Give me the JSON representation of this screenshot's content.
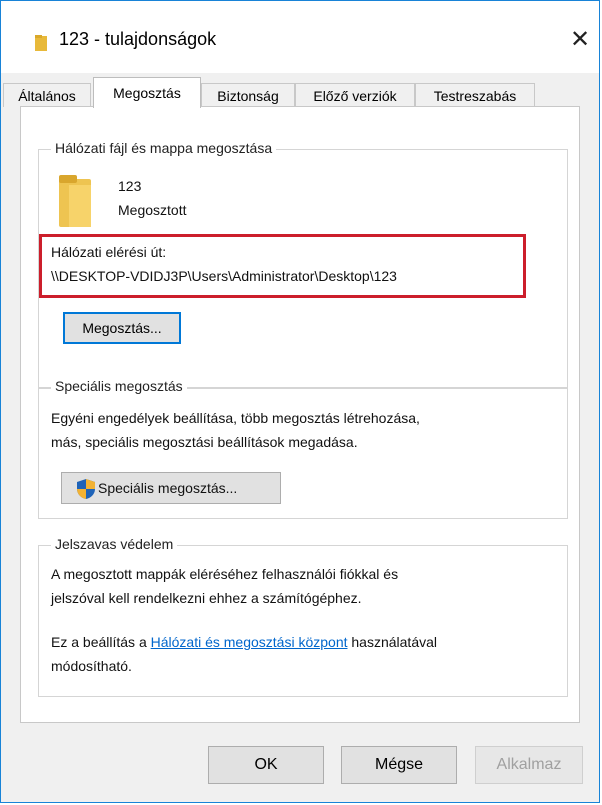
{
  "window": {
    "title": "123 - tulajdonságok",
    "close_glyph": "✕"
  },
  "tabs": [
    {
      "label": "Általános"
    },
    {
      "label": "Megosztás"
    },
    {
      "label": "Biztonság"
    },
    {
      "label": "Előző verziók"
    },
    {
      "label": "Testreszabás"
    }
  ],
  "sharing_group": {
    "title": "Hálózati fájl és mappa megosztása",
    "folder_name": "123",
    "folder_status": "Megosztott",
    "network_path_label": "Hálózati elérési út:",
    "network_path": "\\\\DESKTOP-VDIDJ3P\\Users\\Administrator\\Desktop\\123",
    "share_button": "Megosztás..."
  },
  "advanced_group": {
    "title": "Speciális megosztás",
    "description_line1": "Egyéni engedélyek beállítása, több megosztás létrehozása,",
    "description_line2": "más, speciális megosztási beállítások megadása.",
    "button": "Speciális megosztás..."
  },
  "password_group": {
    "title": "Jelszavas védelem",
    "line1": "A megosztott mappák eléréséhez felhasználói fiókkal és",
    "line2": "jelszóval kell rendelkezni ehhez a számítógéphez.",
    "line3_prefix": "Ez a beállítás a ",
    "link": "Hálózati és megosztási központ",
    "line3_suffix": " használatával",
    "line4": "módosítható."
  },
  "footer": {
    "ok": "OK",
    "cancel": "Mégse",
    "apply": "Alkalmaz"
  },
  "colors": {
    "highlight_border": "#cc1e2b",
    "focus_border": "#0078d7",
    "link": "#0066cc",
    "folder": "#f4c84a"
  },
  "icons": {
    "title": "folder-icon",
    "shared_folder": "folder-icon",
    "advanced_button": "uac-shield-icon",
    "close": "close-icon"
  }
}
